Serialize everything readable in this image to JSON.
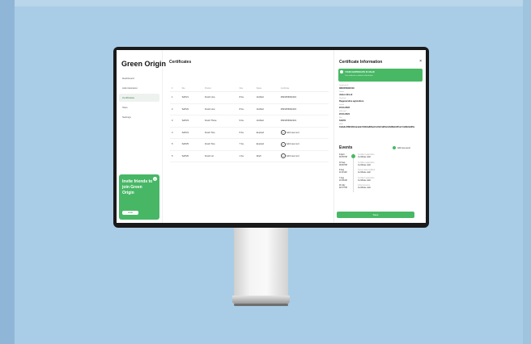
{
  "brand": "Green Origin",
  "nav": [
    "Dashboard",
    "Administration",
    "Certificates",
    "Sites",
    "Settings"
  ],
  "promo": {
    "text": "Invite friends to join Green Origin",
    "button": "Invite"
  },
  "main": {
    "title": "Certificates",
    "columns": [
      "#",
      "Site",
      "Product",
      "Size",
      "Status",
      "Certificate"
    ],
    "rows": [
      {
        "n": "1",
        "site": "SAP21",
        "product": "Fresh Line",
        "size": "8 ha",
        "status": "Verified",
        "status_type": "verified",
        "cert": "0823456932119"
      },
      {
        "n": "2",
        "site": "SAP22",
        "product": "Fresh Line",
        "size": "8 ha",
        "status": "Verified",
        "status_type": "verified",
        "cert": "0823456932119"
      },
      {
        "n": "3",
        "site": "SAP23",
        "product": "Fresh Three",
        "size": "9 ha",
        "status": "Verified",
        "status_type": "verified",
        "cert": "0823456932119"
      },
      {
        "n": "4",
        "site": "SAP24",
        "product": "Fresh Two",
        "size": "5 ha",
        "status": "Expired",
        "status_type": "expired",
        "cert": "Add new cert"
      },
      {
        "n": "5",
        "site": "SAP25",
        "product": "Fresh Two",
        "size": "7 ha",
        "status": "Expired",
        "status_type": "expired",
        "cert": "Add new cert"
      },
      {
        "n": "6",
        "site": "SAP26",
        "product": "Fresh Lin",
        "size": "1 ha",
        "status": "Draft",
        "status_type": "draft",
        "cert": "Add new cert"
      }
    ]
  },
  "panel": {
    "title": "Certificate Information",
    "close": "×",
    "banner_title": "YOUR CERTIFICATE IS VALID",
    "banner_text": "This certificate is verified on blockchain",
    "fields": [
      {
        "label": "Certificate ID",
        "value": "0823456932119"
      },
      {
        "label": "Owner",
        "value": "James Brook"
      },
      {
        "label": "Standard",
        "value": "Regenerative agriculture"
      },
      {
        "label": "Issued",
        "value": "23.04.2023"
      },
      {
        "label": "Valid until",
        "value": "23.04.2024"
      },
      {
        "label": "Site",
        "value": "SAP21"
      },
      {
        "label": "Hash",
        "value": "0x9a3c4f8f2d6b1a4e9c7d0b3a6f8e2c1d4b7a9f0e3c6d8b2a5f1e7c4d9b0a3f6e"
      }
    ],
    "events_title": "Events",
    "add_event": "Add new event",
    "events": [
      {
        "date": "9 April",
        "time": "09:35 PM",
        "event": "Certified registration",
        "result": "Certificate valid"
      },
      {
        "date": "10 Sep",
        "time": "09:00 PM",
        "event": "Certified registration",
        "result": "Certificate valid"
      },
      {
        "date": "9 Aug",
        "time": "11:00 AM",
        "event": "Owner data modified",
        "result": "Certificate valid"
      },
      {
        "date": "7 Aug",
        "time": "10:45 AM",
        "event": "Certified registration",
        "result": "Certificate valid"
      },
      {
        "date": "29 July",
        "time": "02:07 PM",
        "event": "Initial issuance",
        "result": "Certificate valid"
      }
    ],
    "save": "Save"
  }
}
